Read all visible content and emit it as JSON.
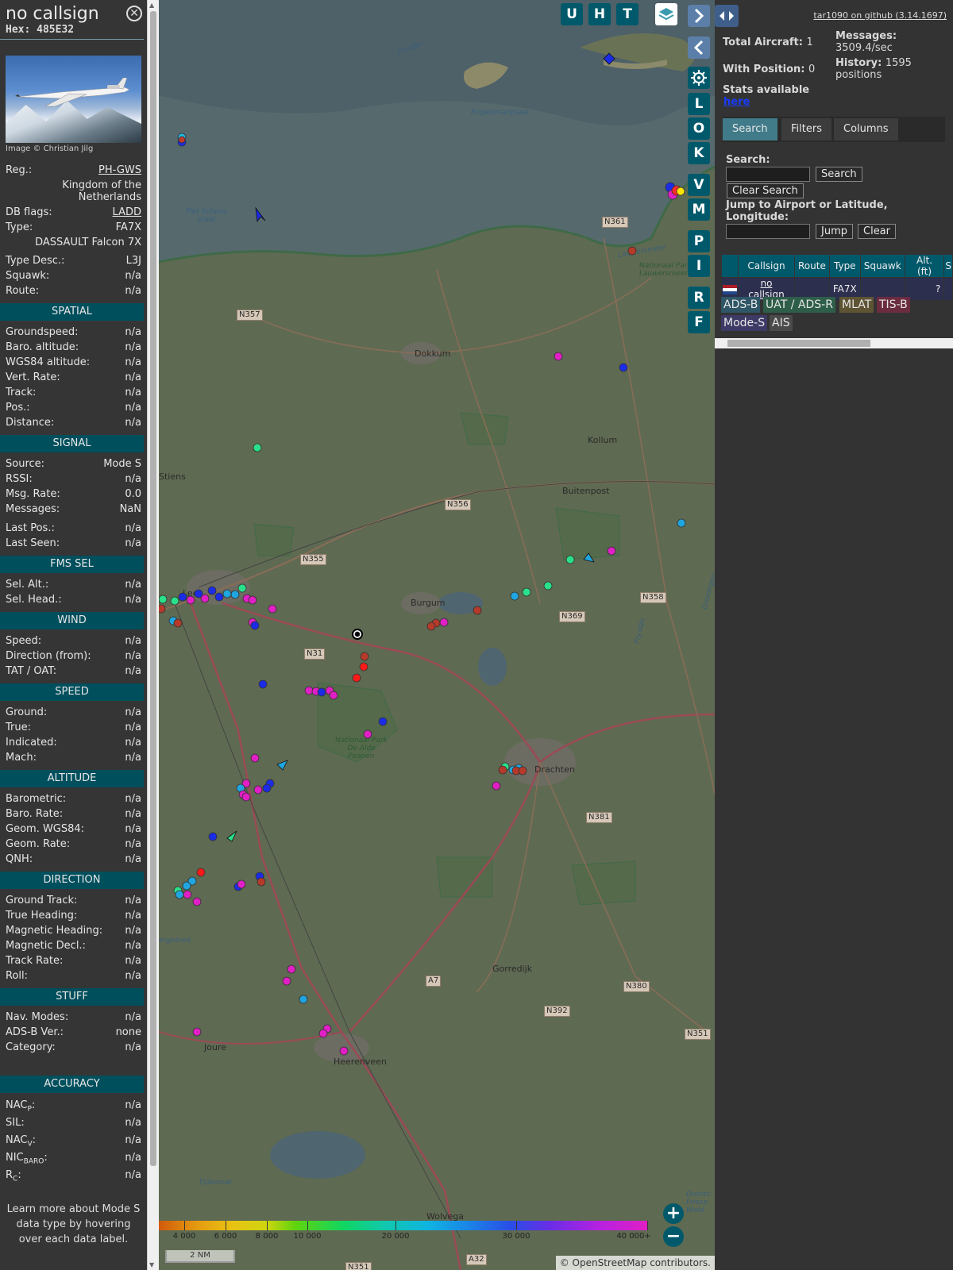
{
  "info": {
    "callsign": "no callsign",
    "hex": "Hex: 485E32",
    "photo_credit": "Image © Christian Jilg",
    "reg_label": "Reg.:",
    "reg_value": "PH-GWS",
    "country": "Kingdom of the Netherlands",
    "dbflags_label": "DB flags:",
    "dbflags_value": "LADD",
    "type_label": "Type:",
    "type_value": "FA7X",
    "type_full": "DASSAULT Falcon 7X",
    "typedesc_label": "Type Desc.:",
    "typedesc_value": "L3J",
    "squawk_label": "Squawk:",
    "squawk_value": "n/a",
    "route_label": "Route:",
    "route_value": "n/a",
    "sections": {
      "spatial": "SPATIAL",
      "signal": "SIGNAL",
      "fmssel": "FMS SEL",
      "wind": "WIND",
      "speed": "SPEED",
      "altitude": "ALTITUDE",
      "direction": "DIRECTION",
      "stuff": "STUFF",
      "accuracy": "ACCURACY"
    },
    "spatial": [
      {
        "label": "Groundspeed:",
        "value": "n/a"
      },
      {
        "label": "Baro. altitude:",
        "value": "n/a"
      },
      {
        "label": "WGS84 altitude:",
        "value": "n/a"
      },
      {
        "label": "Vert. Rate:",
        "value": "n/a"
      },
      {
        "label": "Track:",
        "value": "n/a"
      },
      {
        "label": "Pos.:",
        "value": "n/a"
      },
      {
        "label": "Distance:",
        "value": "n/a"
      }
    ],
    "signal": [
      {
        "label": "Source:",
        "value": "Mode S"
      },
      {
        "label": "RSSI:",
        "value": "n/a"
      },
      {
        "label": "Msg. Rate:",
        "value": "0.0"
      },
      {
        "label": "Messages:",
        "value": "NaN"
      },
      {
        "label": "Last Pos.:",
        "value": "n/a"
      },
      {
        "label": "Last Seen:",
        "value": "n/a"
      }
    ],
    "fmssel": [
      {
        "label": "Sel. Alt.:",
        "value": "n/a"
      },
      {
        "label": "Sel. Head.:",
        "value": "n/a"
      }
    ],
    "wind": [
      {
        "label": "Speed:",
        "value": "n/a"
      },
      {
        "label": "Direction (from):",
        "value": "n/a"
      },
      {
        "label": "TAT / OAT:",
        "value": "n/a"
      }
    ],
    "speed": [
      {
        "label": "Ground:",
        "value": "n/a"
      },
      {
        "label": "True:",
        "value": "n/a"
      },
      {
        "label": "Indicated:",
        "value": "n/a"
      },
      {
        "label": "Mach:",
        "value": "n/a"
      }
    ],
    "altitude": [
      {
        "label": "Barometric:",
        "value": "n/a"
      },
      {
        "label": "Baro. Rate:",
        "value": "n/a"
      },
      {
        "label": "Geom. WGS84:",
        "value": "n/a"
      },
      {
        "label": "Geom. Rate:",
        "value": "n/a"
      },
      {
        "label": "QNH:",
        "value": "n/a"
      }
    ],
    "direction": [
      {
        "label": "Ground Track:",
        "value": "n/a"
      },
      {
        "label": "True Heading:",
        "value": "n/a"
      },
      {
        "label": "Magnetic Heading:",
        "value": "n/a"
      },
      {
        "label": "Magnetic Decl.:",
        "value": "n/a"
      },
      {
        "label": "Track Rate:",
        "value": "n/a"
      },
      {
        "label": "Roll:",
        "value": "n/a"
      }
    ],
    "stuff": [
      {
        "label": "Nav. Modes:",
        "value": "n/a"
      },
      {
        "label": "ADS-B Ver.:",
        "value": "none"
      },
      {
        "label": "Category:",
        "value": "n/a"
      }
    ],
    "accuracy": [
      {
        "label": "NAC",
        "sub": "P",
        "value": "n/a"
      },
      {
        "label": "SIL:",
        "sub": "",
        "value": "n/a"
      },
      {
        "label": "NAC",
        "sub": "V",
        "value": "n/a"
      },
      {
        "label": "NIC",
        "sub": "BARO",
        "value": "n/a"
      },
      {
        "label": "R",
        "sub": "C",
        "value": "n/a"
      }
    ],
    "footer": "Learn more about Mode S data type by hovering over each data label."
  },
  "map": {
    "buttons_top": [
      "U",
      "H",
      "T"
    ],
    "buttons_side": [
      "L",
      "O",
      "K",
      "V",
      "M",
      "P",
      "I",
      "R",
      "F"
    ],
    "places": [
      {
        "name": "Dokkum"
      },
      {
        "name": "Kollum"
      },
      {
        "name": "Buitenpost"
      },
      {
        "name": "Stiens"
      },
      {
        "name": "Burgum"
      },
      {
        "name": "Drachten"
      },
      {
        "name": "Gorredijk"
      },
      {
        "name": "Joure"
      },
      {
        "name": "Heerenveen"
      },
      {
        "name": "Wolvega"
      },
      {
        "name": "Lee"
      }
    ],
    "water_labels": [
      "Fryslân",
      "Engelsmanplaat",
      "Piet Scheve plaat",
      "Nationaal Park Lauwersmeer",
      "Nationaal Park De Alde Feanen",
      "Tjûkemar",
      "Lauwersmeer",
      "ergebied",
      "Groningen",
      "Fryslân",
      "Drents-Friese Wold"
    ],
    "roads": [
      "N357",
      "N361",
      "N356",
      "N355",
      "N358",
      "N369",
      "N31",
      "N381",
      "A7",
      "N392",
      "N380",
      "N351",
      "N351",
      "A32"
    ],
    "scale": "2 NM",
    "attribution": "© OpenStreetMap contributors.",
    "colorbar_ticks": [
      "4 000",
      "6 000",
      "8 000",
      "10 000",
      "20 000",
      "30 000",
      "40 000+"
    ],
    "zoom_in": "+",
    "zoom_out": "−"
  },
  "right": {
    "github": "tar1090 on github (3.14.1697)",
    "total_label": "Total Aircraft:",
    "total_value": "1",
    "withpos_label": "With Position:",
    "withpos_value": "0",
    "stats_label": "Stats available",
    "stats_link": "here",
    "messages_label": "Messages:",
    "messages_value": "3509.4/sec",
    "history_label": "History:",
    "history_value": "1595 positions",
    "tabs": [
      "Search",
      "Filters",
      "Columns"
    ],
    "search_label": "Search:",
    "search_button": "Search",
    "clear_search": "Clear Search",
    "jump_label": "Jump to Airport or Latitude, Longitude:",
    "jump_button": "Jump",
    "clear_button": "Clear",
    "table_headers": [
      "",
      "Callsign",
      "Route",
      "Type",
      "Squawk",
      "Alt. (ft)",
      "S"
    ],
    "table_rows": [
      {
        "callsign": "no callsign",
        "route": "",
        "type": "FA7X",
        "squawk": "",
        "alt": "?",
        "s": ""
      }
    ],
    "sources": [
      "ADS-B",
      "UAT / ADS-R",
      "MLAT",
      "TIS-B",
      "Mode-S",
      "AIS"
    ],
    "colors": {
      "adsb": "#2e5666",
      "uat": "#2e5e49",
      "mlat": "#5e5434",
      "tisb": "#6b2c3f",
      "modes": "#3d3a66",
      "ais": "#4a4a4a",
      "accent": "#00596b"
    }
  }
}
